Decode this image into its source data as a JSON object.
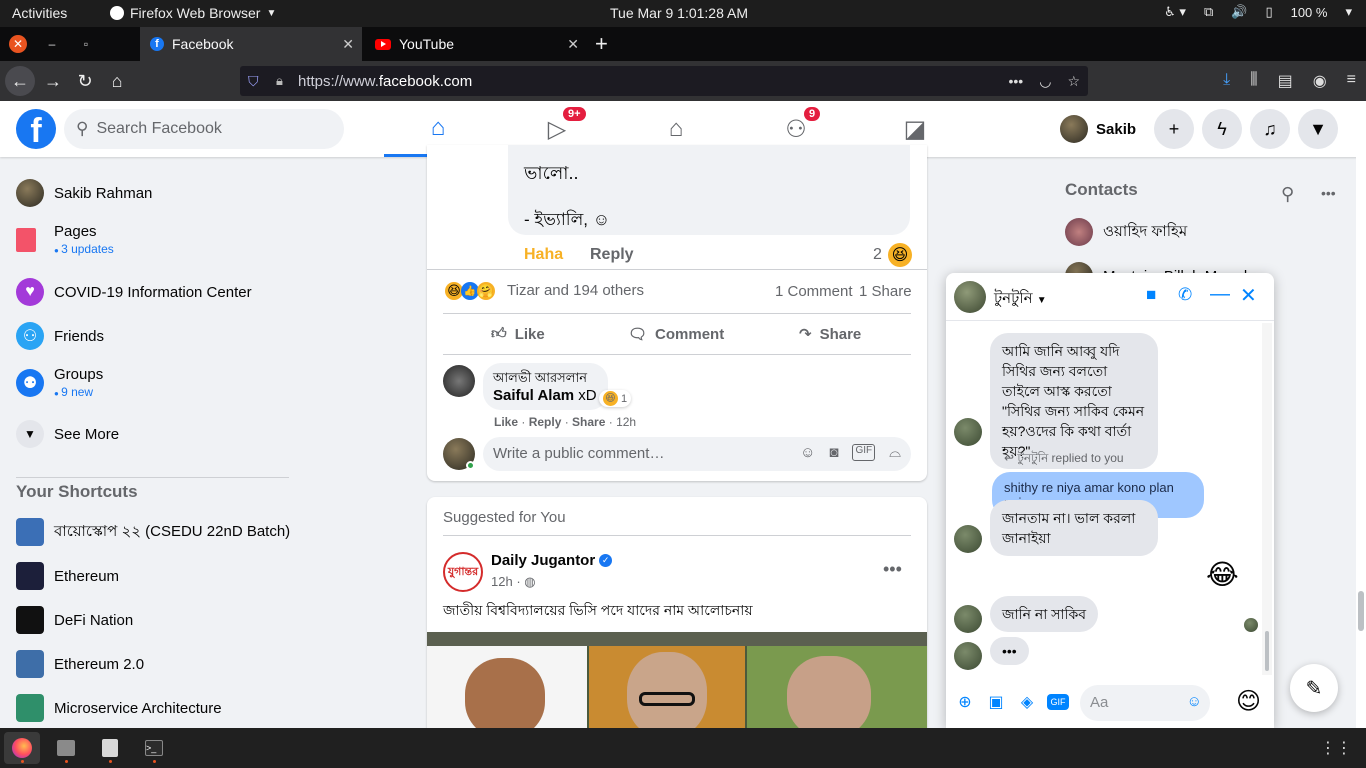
{
  "system": {
    "activities": "Activities",
    "app_name": "Firefox Web Browser",
    "clock": "Tue Mar 9   1:01:28 AM",
    "battery": "100 %"
  },
  "browser": {
    "tabs": [
      {
        "title": "Facebook"
      },
      {
        "title": "YouTube"
      }
    ],
    "url_prefix": "https://www.",
    "url_domain": "facebook.com"
  },
  "fb_header": {
    "logo": "f",
    "search_placeholder": "Search Facebook",
    "watch_badge": "9+",
    "groups_badge": "9",
    "profile_name": "Sakib"
  },
  "left_sidebar": {
    "profile": "Sakib Rahman",
    "pages": {
      "label": "Pages",
      "sub": "3 updates"
    },
    "covid": "COVID-19 Information Center",
    "friends": "Friends",
    "groups": {
      "label": "Groups",
      "sub": "9 new"
    },
    "see_more": "See More",
    "shortcuts_heading": "Your Shortcuts",
    "shortcuts": [
      {
        "label": "বায়োস্কোপ ২২ (CSEDU 22nD Batch)",
        "color": "#3b6fb6"
      },
      {
        "label": "Ethereum",
        "color": "#1c1f3a"
      },
      {
        "label": "DeFi Nation",
        "color": "#111111"
      },
      {
        "label": "Ethereum 2.0",
        "color": "#3e6ea8"
      },
      {
        "label": "Microservice Architecture",
        "color": "#2f8f6a"
      }
    ]
  },
  "post": {
    "quote_line1": "ভালো..",
    "quote_line2": "- ইভ্যালি, ☺",
    "reply_haha": "Haha",
    "reply_reply": "Reply",
    "reaction_count_small": "2",
    "reactions_summary": "Tizar and 194 others",
    "comment_count": "1 Comment",
    "share_count": "1 Share",
    "like": "Like",
    "comment": "Comment",
    "share": "Share",
    "comment_author_tag": "আলভী আরসলান",
    "comment_text_bold": "Saiful Alam",
    "comment_text": " xD",
    "comment_reacts": "1",
    "comment_like": "Like",
    "comment_reply": "Reply",
    "comment_share": "Share",
    "comment_time": "12h",
    "write_placeholder": "Write a public comment…"
  },
  "suggested": {
    "label": "Suggested for You",
    "page_name": "Daily Jugantor",
    "time": "12h",
    "headline": "জাতীয় বিশ্ববিদ্যালয়ের ভিসি পদে যাদের নাম আলোচনায়",
    "logo_text": "যুগান্তর"
  },
  "contacts": {
    "title": "Contacts",
    "items": [
      {
        "name": "ওয়াহিদ ফাহিম"
      },
      {
        "name": "Mostaim Billah Murad"
      }
    ]
  },
  "chat": {
    "name": "টুনটুনি",
    "messages": {
      "m1": "আমি জানি আব্বু যদি সিথির জন্য বলতো তাইলে আস্ক করতো \"সিথির জন্য সাকিব কেমন হয়?ওদের কি কথা বার্তা হয়?\"",
      "replied_note": "টুনটুনি replied to you",
      "quoted": "shithy re niya amar kono plan nai",
      "m2": "জানতাম না। ভাল করলা জানাইয়া",
      "emoji_reply": "😂",
      "m3": "জানি না সাকিব",
      "typing": "•••"
    },
    "input_placeholder": "Aa",
    "gif_label": "GIF"
  }
}
